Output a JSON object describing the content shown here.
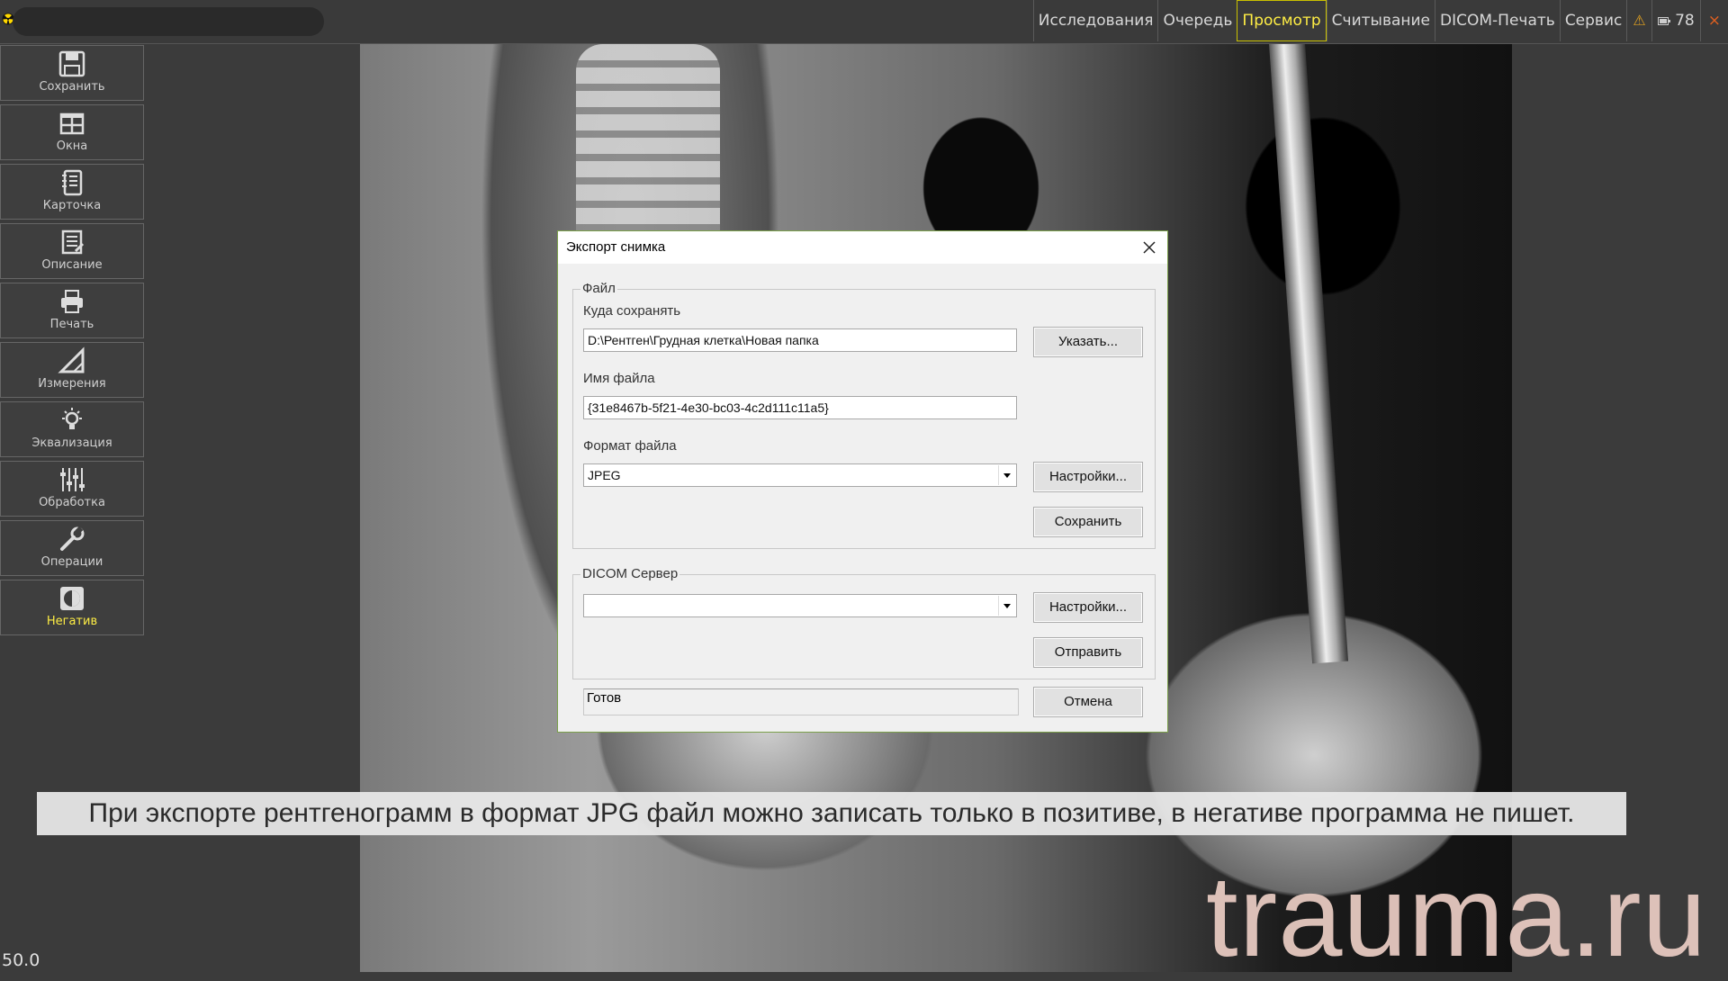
{
  "topbar": {
    "menu": [
      "Исследования",
      "Очередь",
      "Просмотр",
      "Считывание",
      "DICOM-Печать",
      "Сервис"
    ],
    "active_menu": "Просмотр",
    "battery": "78"
  },
  "sidebar": {
    "tools": [
      {
        "label": "Сохранить",
        "icon": "floppy-icon"
      },
      {
        "label": "Окна",
        "icon": "windows-grid-icon"
      },
      {
        "label": "Карточка",
        "icon": "notebook-icon"
      },
      {
        "label": "Описание",
        "icon": "description-icon"
      },
      {
        "label": "Печать",
        "icon": "printer-icon"
      },
      {
        "label": "Измерения",
        "icon": "ruler-triangle-icon"
      },
      {
        "label": "Эквализация",
        "icon": "bulb-icon"
      },
      {
        "label": "Обработка",
        "icon": "sliders-icon"
      },
      {
        "label": "Операции",
        "icon": "wrench-icon"
      },
      {
        "label": "Негатив",
        "icon": "negative-icon"
      }
    ],
    "active_tool": "Негатив"
  },
  "dialog": {
    "title": "Экспорт снимка",
    "file_group": {
      "legend": "Файл",
      "path_label": "Куда сохранять",
      "path_value": "D:\\Рентген\\Грудная клетка\\Новая папка",
      "browse_button": "Указать...",
      "filename_label": "Имя файла",
      "filename_value": "{31e8467b-5f21-4e30-bc03-4c2d111c11a5}",
      "format_label": "Формат файла",
      "format_value": "JPEG",
      "settings_button": "Настройки...",
      "save_button": "Сохранить"
    },
    "dicom_group": {
      "legend": "DICOM Сервер",
      "server_value": "",
      "settings_button": "Настройки...",
      "send_button": "Отправить"
    },
    "status": "Готов",
    "cancel_button": "Отмена"
  },
  "caption": "При экспорте рентгенограмм в формат JPG файл можно записать только в позитиве, в негативе программа не пишет.",
  "watermark": "trauma.ru",
  "zoom": "50.0",
  "colors": {
    "accent": "#ffee44",
    "background": "#3b3b3b",
    "dialog_border": "#7ba04b",
    "watermark": "#e6c9c0"
  }
}
